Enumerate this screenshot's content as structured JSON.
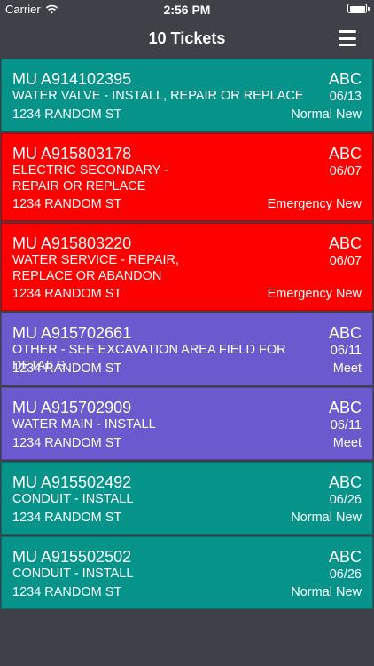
{
  "status_bar": {
    "carrier": "Carrier",
    "time": "2:56 PM"
  },
  "nav": {
    "title": "10 Tickets",
    "menu_icon": "hamburger-menu-icon"
  },
  "colors": {
    "normal": "#06938a",
    "emergency": "#fe0000",
    "meet": "#6b5acd",
    "background": "#3e4148"
  },
  "tickets": [
    {
      "id": "MU A914102395",
      "company": "ABC",
      "description": "WATER VALVE - INSTALL, REPAIR OR REPLACE",
      "date": "06/13",
      "address": "1234 RANDOM ST",
      "status": "Normal New",
      "color": "#06938a"
    },
    {
      "id": "MU A915803178",
      "company": "ABC",
      "description": "ELECTRIC SECONDARY - REPAIR OR REPLACE",
      "date": "06/07",
      "address": "1234 RANDOM ST",
      "status": "Emergency New",
      "color": "#fe0000"
    },
    {
      "id": "MU A915803220",
      "company": "ABC",
      "description": "WATER SERVICE - REPAIR, REPLACE OR ABANDON",
      "date": "06/07",
      "address": "1234 RANDOM ST",
      "status": "Emergency New",
      "color": "#fe0000"
    },
    {
      "id": "MU A915702661",
      "company": "ABC",
      "description": "OTHER - SEE EXCAVATION AREA FIELD FOR DETAILS",
      "date": "06/11",
      "address": "1234 RANDOM ST",
      "status": "Meet",
      "color": "#6b5acd"
    },
    {
      "id": "MU A915702909",
      "company": "ABC",
      "description": "WATER MAIN - INSTALL",
      "date": "06/11",
      "address": "1234 RANDOM ST",
      "status": "Meet",
      "color": "#6b5acd"
    },
    {
      "id": "MU A915502492",
      "company": "ABC",
      "description": "CONDUIT - INSTALL",
      "date": "06/26",
      "address": "1234 RANDOM ST",
      "status": "Normal New",
      "color": "#06938a"
    },
    {
      "id": "MU A915502502",
      "company": "ABC",
      "description": "CONDUIT - INSTALL",
      "date": "06/26",
      "address": "1234 RANDOM ST",
      "status": "Normal New",
      "color": "#06938a"
    }
  ]
}
